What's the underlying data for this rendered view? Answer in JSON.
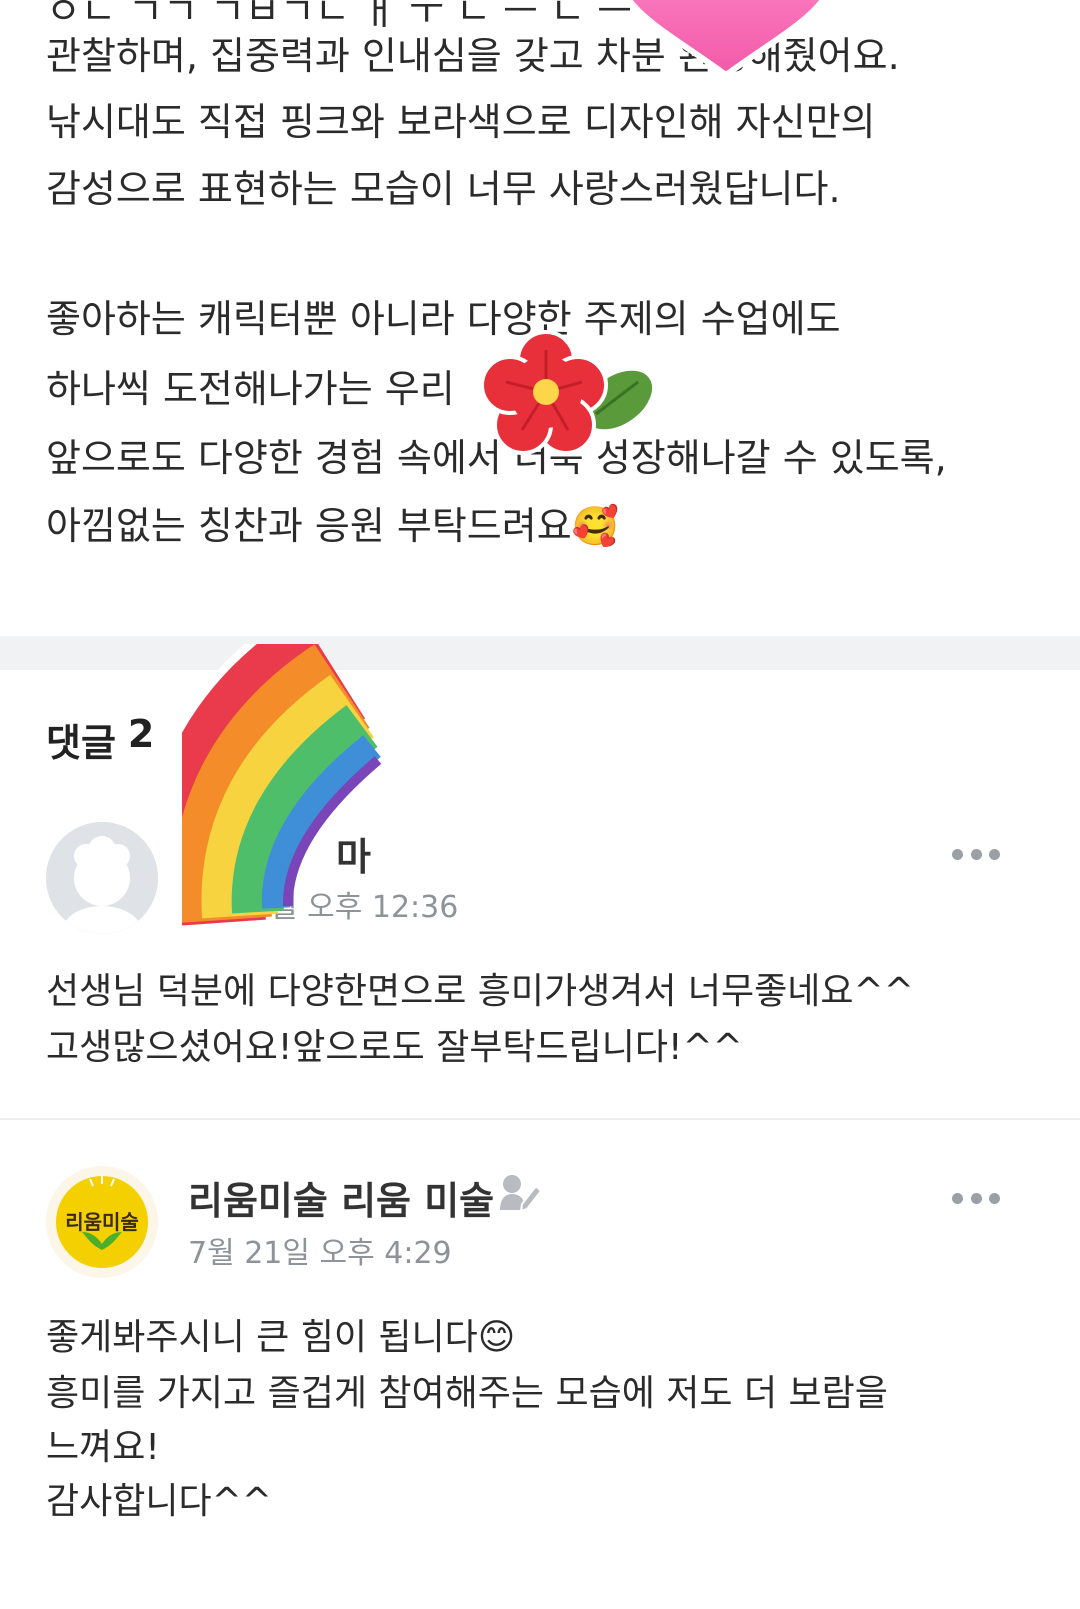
{
  "post": {
    "lines_partial_top": "ㅇㄴ ㄱㄱ ㄱㅂㄱㄴ ㅐ ㅜ ㄴ ㅡ ㄴ ㅡ",
    "lines": [
      "관찰하며, 집중력과 인내심을 갖고 차분    완성해줬어요.",
      "낚시대도 직접 핑크와 보라색으로 디자인해 자신만의",
      "감성으로 표현하는 모습이 너무 사랑스러웠답니다.",
      "",
      "좋아하는 캐릭터뿐 아니라 다양한 주제의 수업에도",
      "하나씩 도전해나가는 우리",
      "앞으로도 다양한 경험 속에서 더욱 성장해나갈 수 있도록,",
      "아낌없는 칭찬과 응원 부탁드려요🥰"
    ]
  },
  "comments": {
    "header_label": "댓글",
    "count": "2",
    "items": [
      {
        "author": "마",
        "time": "월 오후 12:36",
        "text_lines": [
          "선생님 덕분에 다양한면으로 흥미가생겨서 너무좋네요^^",
          "고생많으셨어요!앞으로도 잘부탁드립니다!^^"
        ]
      },
      {
        "author": "리움미술 리움 미술",
        "avatar_text": "리움미술",
        "time": "7월 21일 오후 4:29",
        "text_lines": [
          "좋게봐주시니 큰 힘이 됩니다😊",
          "흥미를 가지고 즐겁게 참여해주는 모습에 저도 더 보람을",
          "느껴요!",
          "감사합니다^^"
        ]
      }
    ]
  },
  "colors": {
    "divider": "#f0f2f4",
    "muted_text": "#8d9399",
    "brand_yellow": "#f4d000",
    "brand_green": "#4caf2b"
  },
  "icons": {
    "more": "more-dots-icon",
    "editor_badge": "pencil-user-icon",
    "default_avatar": "default-profile-icon"
  }
}
